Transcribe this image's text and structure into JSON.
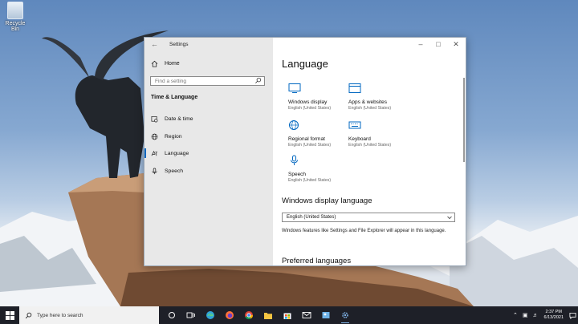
{
  "desktop": {
    "recycle_bin_label": "Recycle Bin"
  },
  "window": {
    "title": "Settings",
    "nav": {
      "home_label": "Home",
      "search_placeholder": "Find a setting",
      "section_title": "Time & Language",
      "items": [
        {
          "label": "Date & time",
          "icon": "calendar-clock-icon",
          "active": false
        },
        {
          "label": "Region",
          "icon": "globe-icon",
          "active": false
        },
        {
          "label": "Language",
          "icon": "language-icon",
          "active": true
        },
        {
          "label": "Speech",
          "icon": "microphone-icon",
          "active": false
        }
      ]
    },
    "content": {
      "page_title": "Language",
      "tiles": [
        {
          "name": "Windows display",
          "sub": "English (United States)",
          "icon": "monitor-icon"
        },
        {
          "name": "Apps & websites",
          "sub": "English (United States)",
          "icon": "app-window-icon"
        },
        {
          "name": "Regional format",
          "sub": "English (United States)",
          "icon": "regional-format-icon"
        },
        {
          "name": "Keyboard",
          "sub": "English (United States)",
          "icon": "keyboard-icon"
        },
        {
          "name": "Speech",
          "sub": "English (United States)",
          "icon": "microphone-icon"
        }
      ],
      "display_language_heading": "Windows display language",
      "display_language_value": "English (United States)",
      "display_language_desc": "Windows features like Settings and File Explorer will appear in this language.",
      "preferred_heading": "Preferred languages"
    }
  },
  "taskbar": {
    "search_placeholder": "Type here to search",
    "time": "2:37 PM",
    "date": "6/13/2021",
    "accent": "#0067c0"
  }
}
